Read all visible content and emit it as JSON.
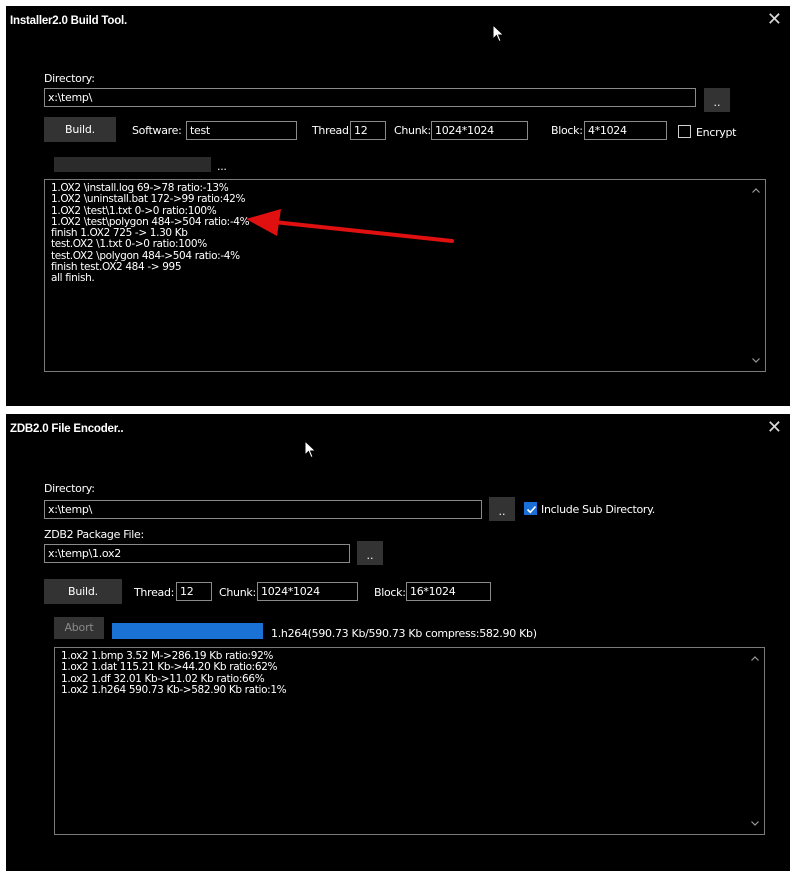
{
  "window1": {
    "title": "Installer2.0 Build Tool.",
    "close_glyph": "✕",
    "directory_label": "Directory:",
    "directory_value": "x:\\temp\\",
    "browse_label": "..",
    "build_label": "Build.",
    "software_label": "Software:",
    "software_value": "test",
    "thread_label": "Thread:",
    "thread_value": "12",
    "chunk_label": "Chunk:",
    "chunk_value": "1024*1024",
    "block_label": "Block:",
    "block_value": "4*1024",
    "encrypt_label": "Encrypt",
    "encrypt_checked": false,
    "progress_ellipsis": "...",
    "progress_fraction": 0,
    "log_lines": [
      "1.OX2 \\install.log 69->78 ratio:-13%",
      "1.OX2 \\uninstall.bat 172->99 ratio:42%",
      "1.OX2 \\test\\1.txt 0->0 ratio:100%",
      "1.OX2 \\test\\polygon 484->504 ratio:-4%",
      "finish 1.OX2 725 -> 1.30 Kb",
      "test.OX2 \\1.txt 0->0 ratio:100%",
      "test.OX2 \\polygon 484->504 ratio:-4%",
      "finish test.OX2 484 -> 995",
      "all finish."
    ]
  },
  "window2": {
    "title": "ZDB2.0 File Encoder..",
    "close_glyph": "✕",
    "directory_label": "Directory:",
    "directory_value": "x:\\temp\\",
    "browse_label": "..",
    "include_sub_label": "Include Sub Directory.",
    "include_sub_checked": true,
    "package_label": "ZDB2 Package File:",
    "package_value": "x:\\temp\\1.ox2",
    "package_browse_label": "..",
    "build_label": "Build.",
    "thread_label": "Thread:",
    "thread_value": "12",
    "chunk_label": "Chunk:",
    "chunk_value": "1024*1024",
    "block_label": "Block:",
    "block_value": "16*1024",
    "abort_label": "Abort",
    "progress_fraction": 1.0,
    "progress_color": "#1a73d4",
    "progress_text": "1.h264(590.73 Kb/590.73 Kb compress:582.90 Kb)",
    "log_lines": [
      "1.ox2 1.bmp 3.52 M->286.19 Kb ratio:92%",
      "1.ox2 1.dat 115.21 Kb->44.20 Kb ratio:62%",
      "1.ox2 1.df 32.01 Kb->11.02 Kb ratio:66%",
      "1.ox2 1.h264 590.73 Kb->582.90 Kb ratio:1%"
    ]
  },
  "annotation": {
    "arrow_color": "#e01010"
  }
}
